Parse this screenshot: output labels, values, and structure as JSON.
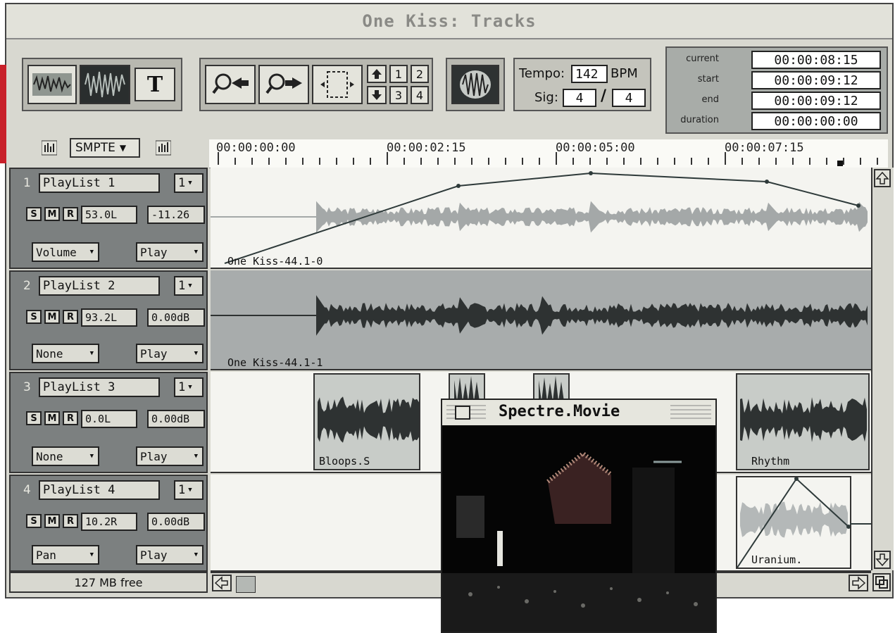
{
  "window": {
    "title": "One Kiss: Tracks"
  },
  "toolbar": {
    "text_tool_label": "T",
    "loc_1": "1",
    "loc_2": "2",
    "loc_3": "3",
    "loc_4": "4",
    "tempo_label": "Tempo:",
    "tempo_value": "142",
    "tempo_unit": "BPM",
    "sig_label": "Sig:",
    "sig_numerator": "4",
    "sig_slash": "/",
    "sig_denominator": "4"
  },
  "timecodes": [
    {
      "label": "current",
      "value": "00:00:08:15"
    },
    {
      "label": "start",
      "value": "00:00:09:12"
    },
    {
      "label": "end",
      "value": "00:00:09:12"
    },
    {
      "label": "duration",
      "value": "00:00:00:00"
    }
  ],
  "ruler": {
    "format": "SMPTE",
    "marks": [
      "00:00:00:00",
      "00:00:02:15",
      "00:00:05:00",
      "00:00:07:15"
    ]
  },
  "tracks": [
    {
      "num": "1",
      "playlist": "PlayList 1",
      "voice": "1",
      "s": "S",
      "m": "M",
      "r": "R",
      "value_a": "53.0L",
      "value_b": "-11.26",
      "view": "Volume",
      "mode": "Play",
      "clip_name": "One Kiss-44.1-0"
    },
    {
      "num": "2",
      "playlist": "PlayList 2",
      "voice": "1",
      "s": "S",
      "m": "M",
      "r": "R",
      "value_a": "93.2L",
      "value_b": "0.00dB",
      "view": "None",
      "mode": "Play",
      "clip_name": "One Kiss-44.1-1"
    },
    {
      "num": "3",
      "playlist": "PlayList 3",
      "voice": "1",
      "s": "S",
      "m": "M",
      "r": "R",
      "value_a": "0.0L",
      "value_b": "0.00dB",
      "view": "None",
      "mode": "Play",
      "clip_name": "Bloops.S"
    },
    {
      "num": "4",
      "playlist": "PlayList 4",
      "voice": "1",
      "s": "S",
      "m": "M",
      "r": "R",
      "value_a": "10.2R",
      "value_b": "0.00dB",
      "view": "Pan",
      "mode": "Play",
      "clip_name": "Uranium."
    }
  ],
  "clips_extra": {
    "rhythm": "Rhythm"
  },
  "status": {
    "free": "127 MB free"
  },
  "movie": {
    "title": "Spectre.Movie"
  },
  "icons": [
    "waveform-tool-icon",
    "zoom-out-icon",
    "zoom-in-icon",
    "selection-icon",
    "arrow-up-icon",
    "arrow-down-icon",
    "scroll-left-icon",
    "scroll-right-icon",
    "scroll-up-icon",
    "scroll-down-icon",
    "grow-box-icon"
  ],
  "colors": {
    "accent_red": "#c8202a",
    "track_header": "#7c8080",
    "waveform": "#2e3232",
    "waveform_light": "#a4a8a8"
  }
}
